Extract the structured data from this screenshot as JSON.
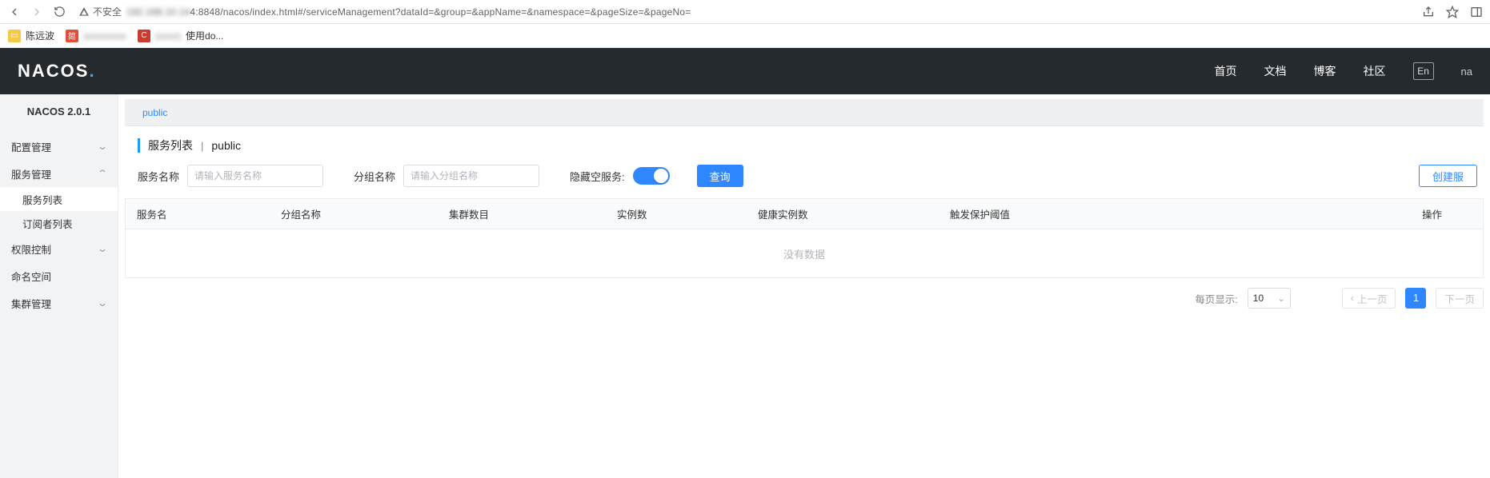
{
  "browser": {
    "insecure_label": "不安全",
    "url_prefix": "4:8848/nacos/index.html#/serviceManagement?dataId=&group=&appName=&namespace=&pageSize=&pageNo="
  },
  "bookmarks": {
    "bm1": "陈远波",
    "bm2_suffix": "",
    "bm3_label": "使用do..."
  },
  "header": {
    "logo_text": "NACOS",
    "nav_home": "首页",
    "nav_docs": "文档",
    "nav_blog": "博客",
    "nav_comm": "社区",
    "lang": "En",
    "cut": "na"
  },
  "sidebar": {
    "version": "NACOS 2.0.1",
    "config_mgmt": "配置管理",
    "service_mgmt": "服务管理",
    "service_list": "服务列表",
    "subscriber_list": "订阅者列表",
    "perm": "权限控制",
    "namespace": "命名空间",
    "cluster": "集群管理"
  },
  "tabs": {
    "public": "public"
  },
  "page": {
    "title": "服务列表",
    "sep": "|",
    "namespace": "public"
  },
  "filters": {
    "service_name_label": "服务名称",
    "service_name_placeholder": "请输入服务名称",
    "group_label": "分组名称",
    "group_placeholder": "请输入分组名称",
    "hide_empty_label": "隐藏空服务:",
    "query_btn": "查询",
    "create_btn": "创建服"
  },
  "table": {
    "col_name": "服务名",
    "col_group": "分组名称",
    "col_cluster": "集群数目",
    "col_inst": "实例数",
    "col_health": "健康实例数",
    "col_threshold": "触发保护阈值",
    "col_op": "操作",
    "empty": "没有数据"
  },
  "pager": {
    "per_page": "每页显示:",
    "size": "10",
    "prev": "上一页",
    "current": "1",
    "next": "下一页"
  }
}
